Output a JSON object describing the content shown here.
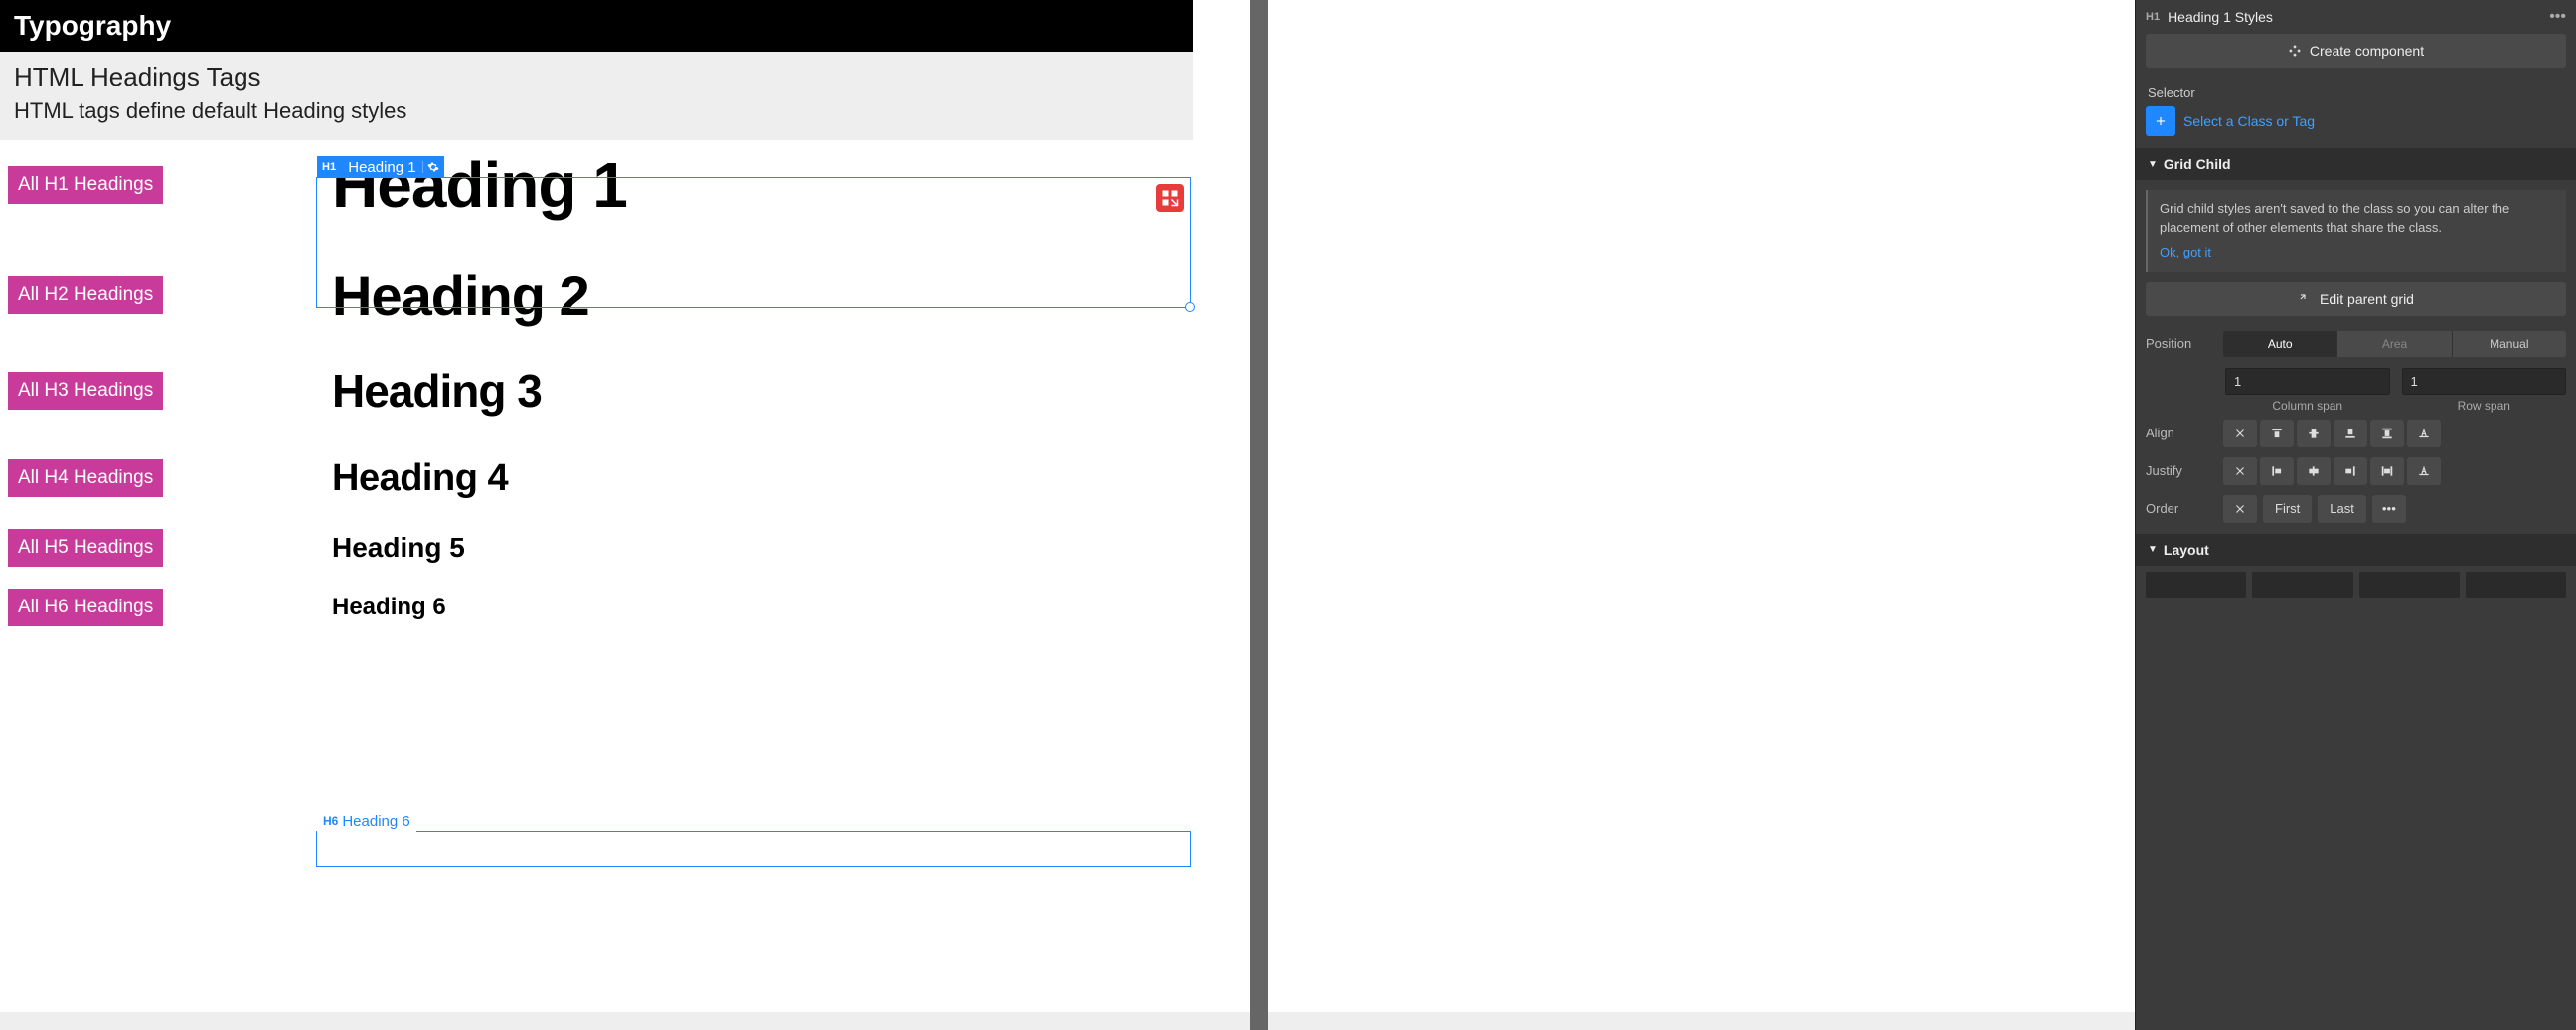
{
  "canvas": {
    "topbar_title": "Typography",
    "section_title": "HTML Headings Tags",
    "section_desc": "HTML tags define default Heading styles",
    "badges": [
      "All H1 Headings",
      "All H2 Headings",
      "All H3 Headings",
      "All H4 Headings",
      "All H5 Headings",
      "All H6 Headings"
    ],
    "headings": [
      "Heading 1",
      "Heading 2",
      "Heading 3",
      "Heading 4",
      "Heading 5",
      "Heading 6"
    ],
    "sel_h1_tag": "H1",
    "sel_h1_label": "Heading 1",
    "sel_h6_tag": "H6",
    "sel_h6_label": "Heading 6"
  },
  "panel": {
    "header_tag": "H1",
    "header_name": "Heading 1 Styles",
    "create_component": "Create component",
    "selector_label": "Selector",
    "selector_placeholder": "Select a Class or Tag",
    "grid_child_title": "Grid Child",
    "grid_child_info": "Grid child styles aren't saved to the class so you can alter the placement of other elements that share the class.",
    "ok_got_it": "Ok, got it",
    "edit_parent": "Edit parent grid",
    "position_label": "Position",
    "position_options": [
      "Auto",
      "Area",
      "Manual"
    ],
    "col_span_value": "1",
    "row_span_value": "1",
    "col_span_label": "Column span",
    "row_span_label": "Row span",
    "align_label": "Align",
    "justify_label": "Justify",
    "order_label": "Order",
    "order_first": "First",
    "order_last": "Last",
    "layout_title": "Layout"
  }
}
